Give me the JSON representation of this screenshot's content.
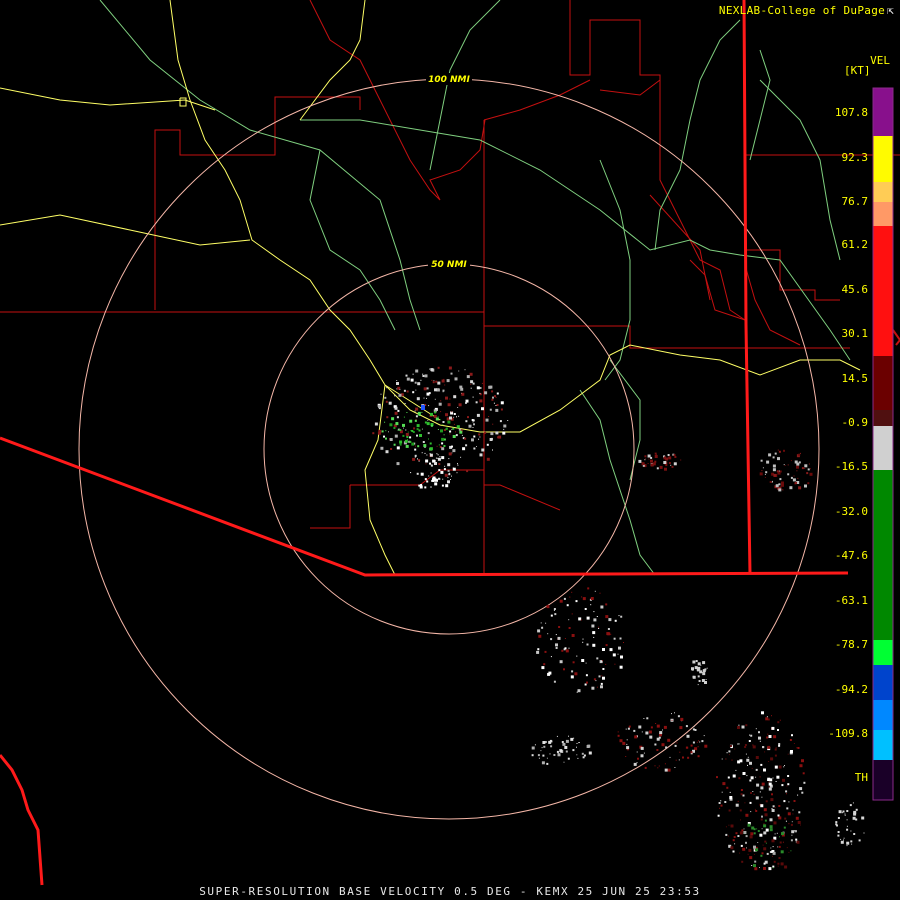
{
  "credit": {
    "text": "NEXLAB-College of DuPage",
    "link_icon": "external-link-icon"
  },
  "footer": {
    "caption": "SUPER-RESOLUTION BASE VELOCITY 0.5 DEG - KEMX 25 JUN 25 23:53"
  },
  "range_rings": {
    "outer_label": "100 NMI",
    "inner_label": "50 NMI"
  },
  "legend": {
    "title": "VEL",
    "unit": "[KT]",
    "labels": [
      "107.8",
      "92.3",
      "76.7",
      "61.2",
      "45.6",
      "30.1",
      "14.5",
      "-0.9",
      "-16.5",
      "-32.0",
      "-47.6",
      "-63.1",
      "-78.7",
      "-94.2",
      "-109.8",
      "TH"
    ]
  },
  "colors": {
    "ring": "#f5b7a8",
    "border_red": "#ff1a1a",
    "county": "#c41010",
    "highway": "#ffff66",
    "river": "#7fcf7f",
    "label_yellow": "#ffff00"
  }
}
